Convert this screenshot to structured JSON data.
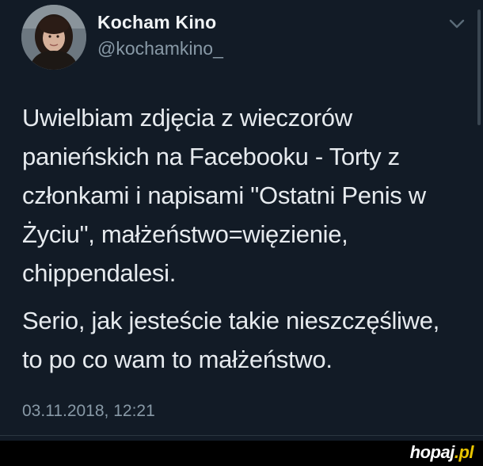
{
  "tweet": {
    "author": {
      "display_name": "Kocham Kino",
      "handle": "@kochamkino_",
      "avatar_icon": "profile-photo"
    },
    "caret_icon": "chevron-down-icon",
    "paragraphs": [
      "Uwielbiam zdjęcia z wieczorów\npanieńskich na Facebooku - Torty z\nczłonkami i napisami \"Ostatni Penis w\nŻyciu\", małżeństwo=więzienie,\nchippendalesi.",
      "Serio, jak jesteście takie nieszczęśliwe,\nto po co wam to małżeństwo."
    ],
    "timestamp": "03.11.2018, 12:21"
  },
  "watermark": {
    "name": "hopaj",
    "tld": ".pl"
  },
  "colors": {
    "background": "#121b26",
    "frame": "#000000",
    "text": "#e6eaee",
    "secondary_text": "#8899a6",
    "watermark_accent": "#e8c400"
  }
}
